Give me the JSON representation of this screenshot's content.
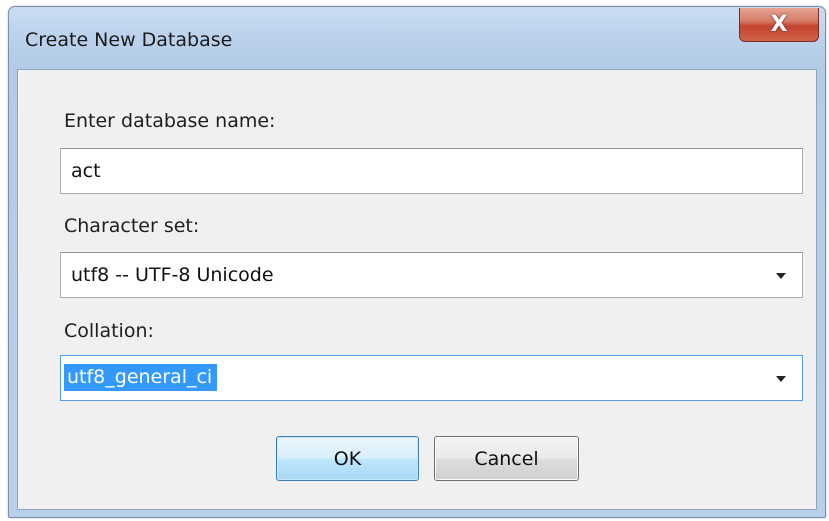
{
  "window": {
    "title": "Create New Database",
    "close_symbol": "X"
  },
  "form": {
    "name_label": "Enter database name:",
    "name_value": "act",
    "charset_label": "Character set:",
    "charset_value": "utf8 -- UTF-8 Unicode",
    "collation_label": "Collation:",
    "collation_value": "utf8_general_ci"
  },
  "buttons": {
    "ok_label": "OK",
    "cancel_label": "Cancel"
  },
  "icons": {
    "close": "close-icon",
    "dropdown": "chevron-down-icon"
  },
  "colors": {
    "selection": "#3399ff",
    "close_button": "#c4432f",
    "window_frame": "#bcd2ec"
  }
}
